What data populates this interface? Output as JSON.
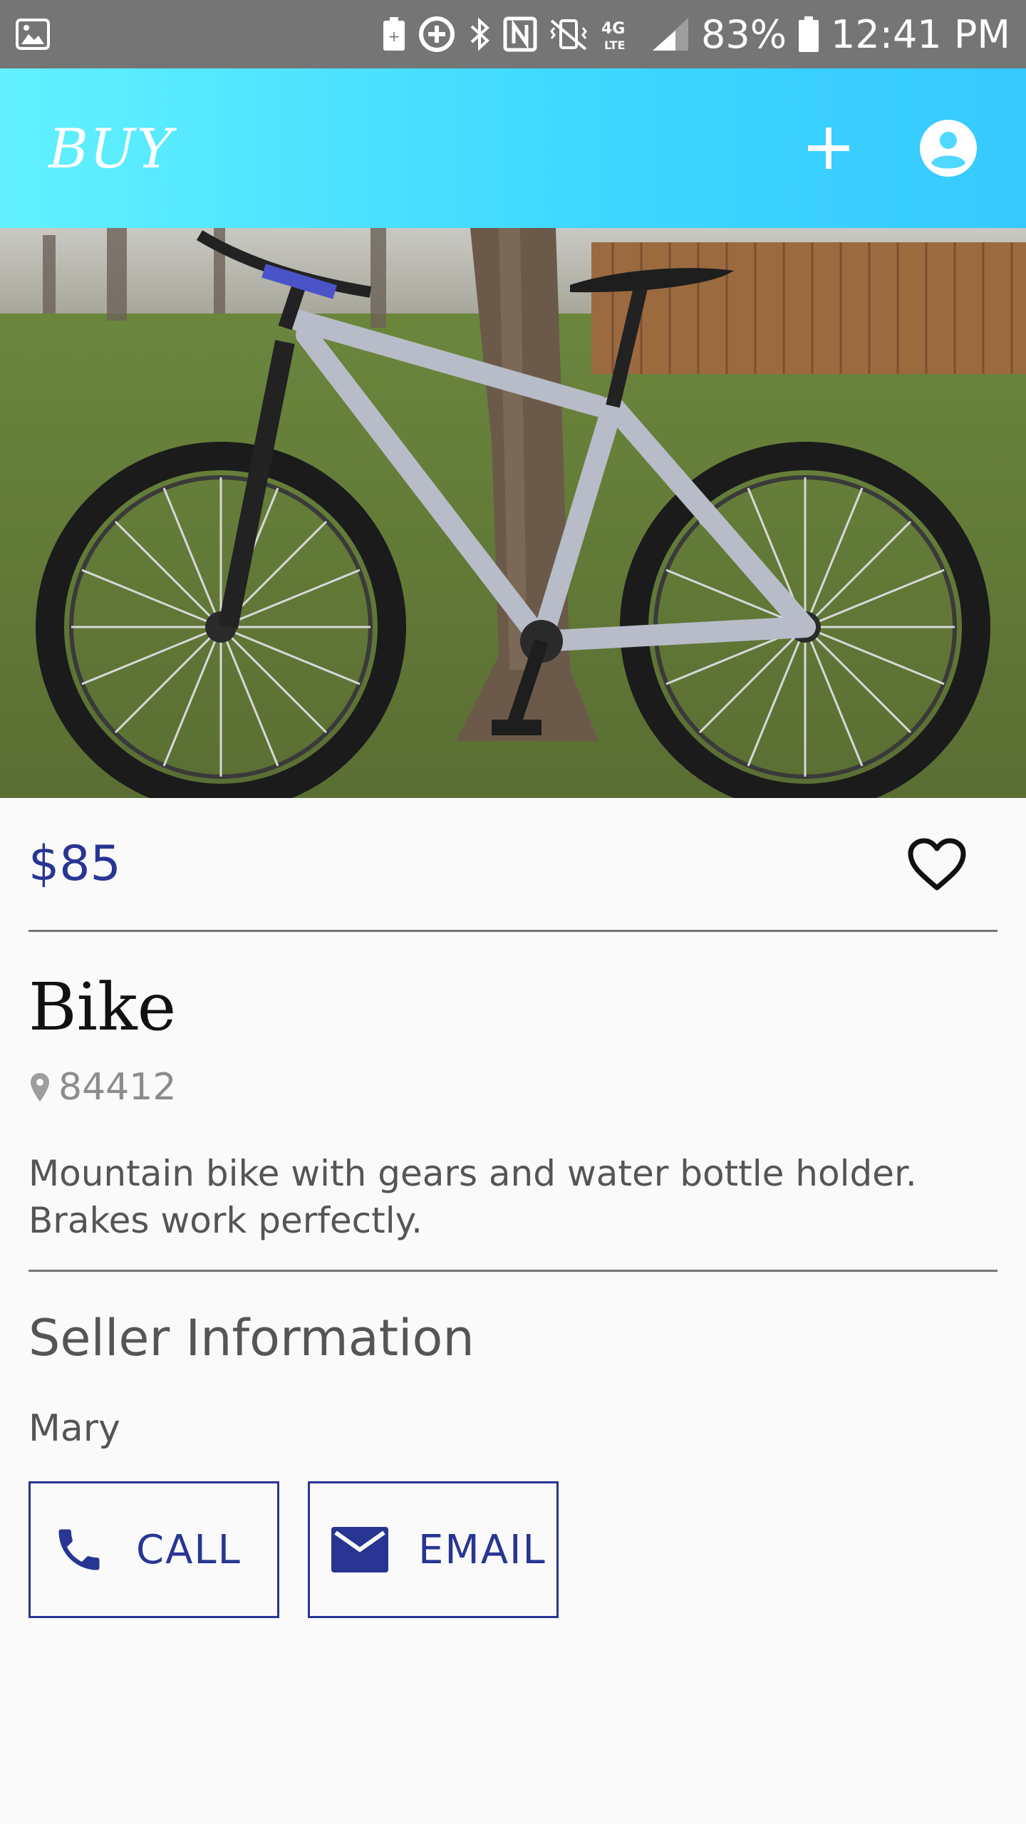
{
  "status_bar": {
    "battery_percent": "83%",
    "time": "12:41 PM",
    "icons": [
      "gallery-icon",
      "battery-saver-icon",
      "data-saver-icon",
      "bluetooth-icon",
      "nfc-icon",
      "vibrate-icon",
      "lte-icon",
      "signal-icon",
      "battery-icon"
    ]
  },
  "app_bar": {
    "title": "BUY",
    "actions": [
      "add-icon",
      "account-icon"
    ]
  },
  "listing": {
    "price": "$85",
    "title": "Bike",
    "location": "84412",
    "description": "Mountain bike with gears and water bottle holder. Brakes work perfectly."
  },
  "seller": {
    "section_title": "Seller Information",
    "name": "Mary",
    "call_label": "CALL",
    "email_label": "EMAIL"
  },
  "colors": {
    "accent": "#283593",
    "app_bar_start": "#62f1ff",
    "app_bar_end": "#36c9ff",
    "status_bar": "#757575"
  }
}
